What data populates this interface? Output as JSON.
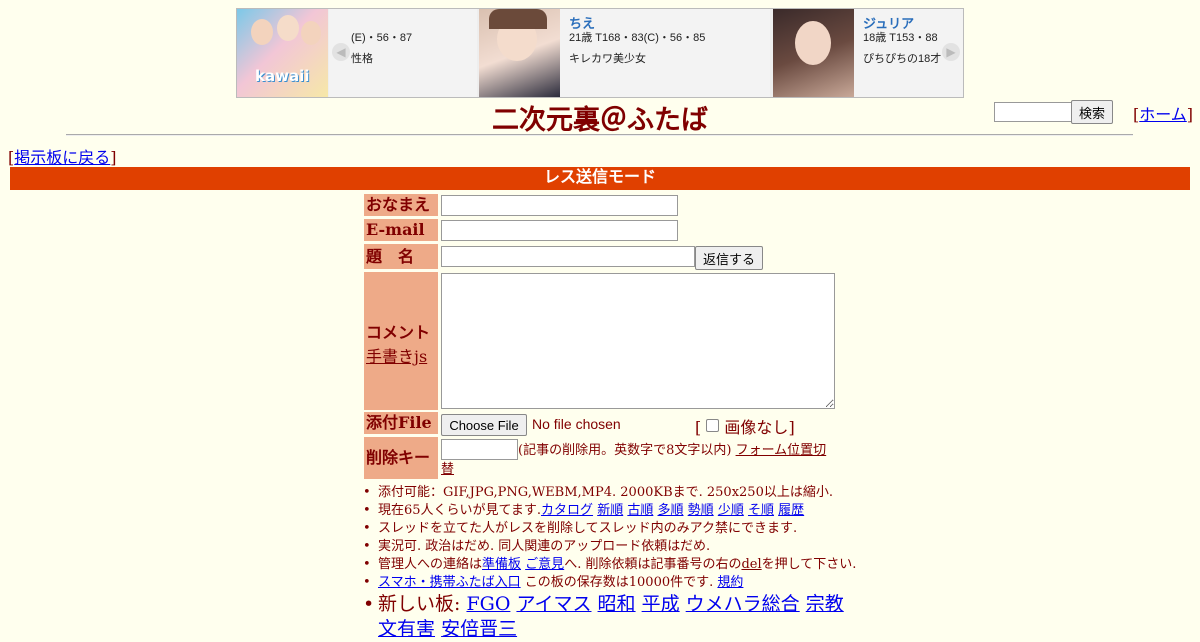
{
  "ad": {
    "cards": [
      {
        "photo_label": "kawaii",
        "line1": "(E)・56・87",
        "line2": "性格",
        "name": ""
      },
      {
        "name": "ちえ",
        "line1": "21歳 T168・83(C)・56・85",
        "line2": "キレカワ美少女"
      },
      {
        "name": "ジュリア",
        "line1": "18歳 T153・88",
        "line2": "ぴちぴちの18才"
      }
    ],
    "prev_arrow": "◀",
    "next_arrow": "▶"
  },
  "header": {
    "title": "二次元裏＠ふたば",
    "search_button": "検索",
    "home_link": "ホーム",
    "back_link": "掲示板に戻る"
  },
  "mode_bar": "レス送信モード",
  "form": {
    "name_label": "おなまえ",
    "email_label": "E-mail",
    "subject_label": "題　名",
    "submit_button": "返信する",
    "comment_label": "コメント",
    "handwrite_link": "手書きjs",
    "file_label": "添付File",
    "file_button": "Choose File",
    "file_status": "No file chosen",
    "no_image_label": "画像なし",
    "delkey_label": "削除キー",
    "delkey_note": "(記事の削除用。英数字で8文字以内)",
    "form_pos_link": "フォーム位置切替"
  },
  "notes": {
    "n1": "添付可能：GIF,JPG,PNG,WEBM,MP4. 2000KBまで. 250x250以上は縮小.",
    "n2_prefix": "現在65人くらいが見てます.",
    "n2_links": [
      "カタログ",
      "新順",
      "古順",
      "多順",
      "勢順",
      "少順",
      "そ順",
      "履歴"
    ],
    "n3": "スレッドを立てた人がレスを削除してスレッド内のみアク禁にできます.",
    "n4": "実況可. 政治はだめ. 同人関連のアップロード依頼はだめ.",
    "n5_a": "管理人への連絡は",
    "n5_link1": "準備板",
    "n5_link2": "ご意見",
    "n5_b": "へ. 削除依頼は記事番号の右の",
    "n5_del": "del",
    "n5_c": "を押して下さい.",
    "n6_link": "スマホ・携帯ふたば入口",
    "n6_text": "この板の保存数は10000件です.",
    "n6_rules": "規約",
    "boards_prefix": "新しい板:",
    "boards": [
      "FGO",
      "アイマス",
      "昭和",
      "平成",
      "ウメハラ総合",
      "宗教",
      "文有害",
      "安倍晋三"
    ]
  }
}
